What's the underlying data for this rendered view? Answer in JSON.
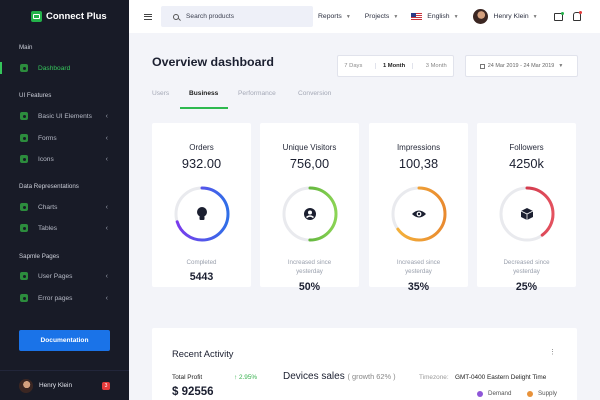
{
  "app": {
    "brand": "Connect Plus"
  },
  "sidebar": {
    "sections": [
      "Main",
      "UI Features",
      "Data Representations",
      "Sapmle Pages"
    ],
    "items": [
      {
        "label": "Dashboard",
        "active": true,
        "chevron": ""
      },
      {
        "label": "Basic UI Elements",
        "chevron": "‹"
      },
      {
        "label": "Forms",
        "chevron": "‹"
      },
      {
        "label": "Icons",
        "chevron": "‹"
      },
      {
        "label": "Charts",
        "chevron": "‹"
      },
      {
        "label": "Tables",
        "chevron": "‹"
      },
      {
        "label": "User Pages",
        "chevron": "‹"
      },
      {
        "label": "Error pages",
        "chevron": "‹"
      }
    ],
    "documentation_label": "Documentation",
    "user": {
      "name": "Henry Klein",
      "badge": "3"
    }
  },
  "topbar": {
    "search_placeholder": "Search products",
    "reports_label": "Reports",
    "projects_label": "Projects",
    "language_label": "English",
    "user_name": "Henry Klein"
  },
  "main": {
    "title": "Overview dashboard",
    "ranges": [
      "7 Days",
      "1 Month",
      "3 Month"
    ],
    "selected_range": "1 Month",
    "date_range": "24 Mar 2019 - 24 Mar 2019",
    "tabs": [
      "Users",
      "Business",
      "Performance",
      "Conversion"
    ],
    "active_tab": "Business",
    "cards": [
      {
        "label": "Orders",
        "value": "932.00",
        "sub": "Completed",
        "foot": "5443",
        "icon": "lightbulb-icon",
        "progress": 0.7,
        "color_start": "#7c3aed",
        "color_end": "#2f6fe8"
      },
      {
        "label": "Unique Visitors",
        "value": "756,00",
        "sub": "Increased since yesterday",
        "foot": "50%",
        "icon": "user-icon",
        "progress": 0.5,
        "color_start": "#3f9b2a",
        "color_end": "#8bd454"
      },
      {
        "label": "Impressions",
        "value": "100,38",
        "sub": "Increased since yesterday",
        "foot": "35%",
        "icon": "eye-icon",
        "progress": 0.65,
        "color_start": "#f5b53c",
        "color_end": "#e98a2f"
      },
      {
        "label": "Followers",
        "value": "4250k",
        "sub": "Decreased since yesterday",
        "foot": "25%",
        "icon": "cube-icon",
        "progress": 0.4,
        "color_start": "#c2223a",
        "color_end": "#e4525f"
      }
    ],
    "recent": {
      "title": "Recent Activity",
      "total_profit_label": "Total Profit",
      "total_profit_change": "↑ 2.95%",
      "total_profit_value": "$ 92556",
      "devices_title": "Devices sales",
      "devices_growth": "( growth 62% )",
      "timezone_label": "Timezone:",
      "timezone_value": "GMT-0400 Eastern Delight Time",
      "legend": [
        {
          "label": "Demand",
          "color": "#8e56d8"
        },
        {
          "label": "Supply",
          "color": "#e8923a"
        }
      ]
    }
  },
  "colors": {
    "accent": "#2eb94f",
    "primary": "#1a73e8",
    "sidebar_bg": "#181b27"
  }
}
